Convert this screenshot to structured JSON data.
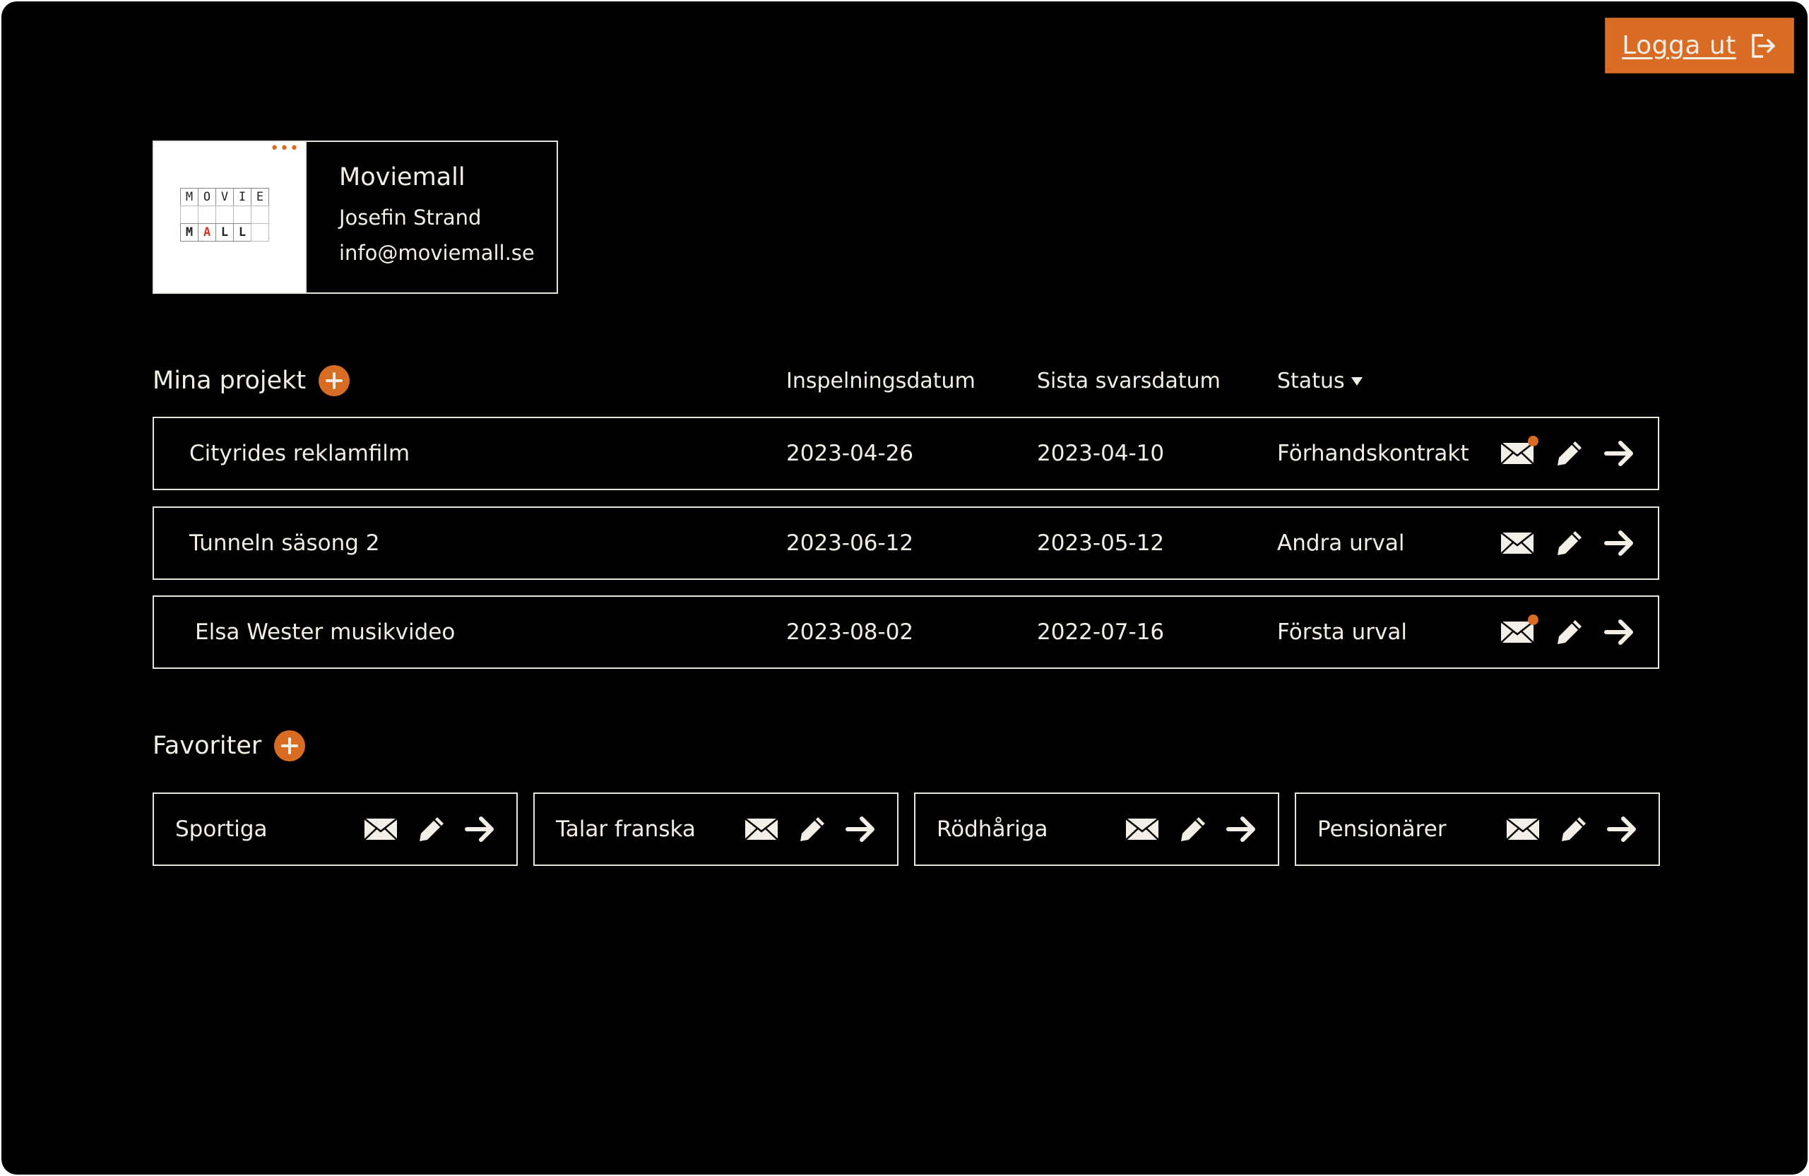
{
  "header": {
    "logout_label": "Logga ut"
  },
  "company": {
    "logo_rows": [
      [
        "M",
        "O",
        "V",
        "I",
        "E"
      ],
      [
        "",
        "",
        "",
        "",
        ""
      ],
      [
        "M",
        "A",
        "L",
        "L",
        ""
      ]
    ],
    "name": "Moviemall",
    "contact_name": "Josefin Strand",
    "email": "info@moviemall.se"
  },
  "projects": {
    "title": "Mina projekt",
    "columns": {
      "shoot_date": "Inspelningsdatum",
      "reply_date": "Sista svarsdatum",
      "status": "Status"
    },
    "rows": [
      {
        "name": "Cityrides reklamfilm",
        "shoot_date": "2023-04-26",
        "reply_date": "2023-04-10",
        "status": "Förhandskontrakt",
        "unread": true
      },
      {
        "name": "Tunneln säsong 2",
        "shoot_date": "2023-06-12",
        "reply_date": "2023-05-12",
        "status": "Andra urval",
        "unread": false
      },
      {
        "name": "Elsa Wester musikvideo",
        "shoot_date": "2023-08-02",
        "reply_date": "2022-07-16",
        "status": "Första urval",
        "unread": true
      }
    ]
  },
  "favorites": {
    "title": "Favoriter",
    "items": [
      {
        "label": "Sportiga"
      },
      {
        "label": "Talar franska"
      },
      {
        "label": "Rödhåriga"
      },
      {
        "label": "Pensionärer"
      }
    ]
  },
  "colors": {
    "accent": "#d96c25",
    "background": "#000000",
    "foreground": "#f3efe6"
  },
  "icons": {
    "mail": "mail-icon",
    "edit": "pencil-icon",
    "open": "arrow-right-icon",
    "add": "plus-icon",
    "logout": "logout-icon",
    "more": "more-dots-icon",
    "sort": "caret-down-icon"
  }
}
